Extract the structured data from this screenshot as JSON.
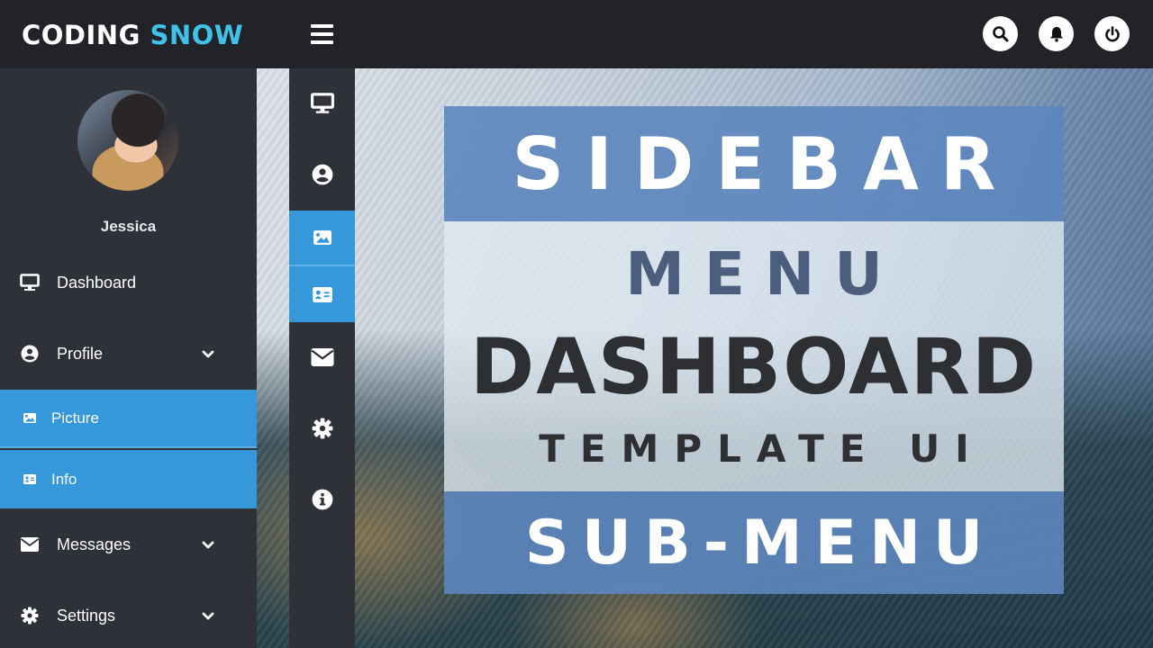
{
  "header": {
    "brand_primary": "CODING",
    "brand_accent": "SNOW",
    "menu_toggle_icon": "hamburger-icon",
    "actions": [
      {
        "name": "search",
        "icon": "search-icon"
      },
      {
        "name": "notifications",
        "icon": "bell-icon"
      },
      {
        "name": "logout",
        "icon": "power-icon"
      }
    ]
  },
  "sidebar": {
    "user": {
      "name": "Jessica",
      "avatar": "profile-photo"
    },
    "items": [
      {
        "label": "Dashboard",
        "icon": "desktop-icon",
        "expandable": false
      },
      {
        "label": "Profile",
        "icon": "user-circle-icon",
        "expandable": true
      },
      {
        "label": "Picture",
        "icon": "image-icon",
        "submenu": true,
        "active": true
      },
      {
        "label": "Info",
        "icon": "id-card-icon",
        "submenu": true,
        "active": true
      },
      {
        "label": "Messages",
        "icon": "envelope-icon",
        "expandable": true
      },
      {
        "label": "Settings",
        "icon": "cog-icon",
        "expandable": true
      }
    ]
  },
  "mobile_sidebar": {
    "items": [
      {
        "icon": "desktop-icon"
      },
      {
        "icon": "user-circle-icon"
      },
      {
        "icon": "image-icon",
        "active": true
      },
      {
        "icon": "id-card-icon",
        "active": true
      },
      {
        "icon": "envelope-icon"
      },
      {
        "icon": "cog-icon"
      },
      {
        "icon": "info-circle-icon"
      }
    ]
  },
  "title_card": {
    "line1": "SIDEBAR",
    "line2": "MENU",
    "line3": "DASHBOARD",
    "line4": "TEMPLATE UI",
    "line5": "SUB-MENU"
  },
  "colors": {
    "topbar": "#222329",
    "sidebar": "#2f3139",
    "accent_blue": "#3498db",
    "brand_accent": "#3fc1e8",
    "card_blue": "#5d86be"
  }
}
